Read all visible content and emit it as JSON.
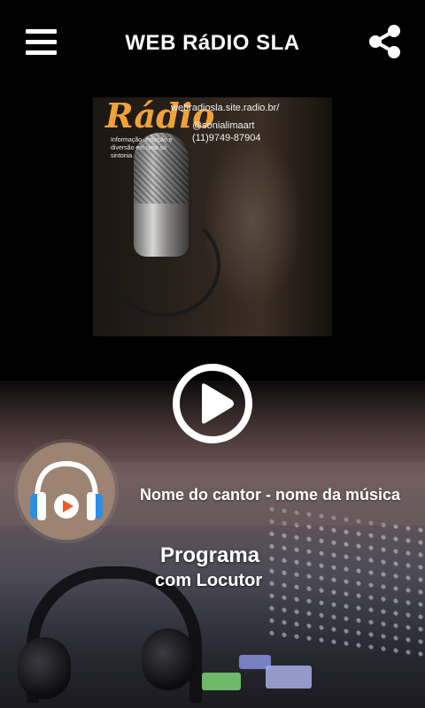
{
  "header": {
    "title": "WEB RáDIO SLA",
    "menu_icon": "hamburger-menu-icon",
    "share_icon": "share-icon"
  },
  "album_art": {
    "logo_text": "Rádio",
    "tagline": "Informação, emoção e diversão em uma só sintonia",
    "url": "webradiosla.site.radio.br/",
    "instagram": "@sonialimaart",
    "phone": "(11)9749-87904"
  },
  "player": {
    "play_icon": "play-icon",
    "station_logo_icon": "headphones-icon",
    "now_playing": "Nome do cantor - nome da música",
    "program": "Programa",
    "host": "com Locutor"
  },
  "colors": {
    "background": "#000000",
    "text": "#ffffff",
    "logo_orange": "#f0a23a",
    "station_logo_bg": "#9c8372",
    "headphone_blue": "#2f8de4",
    "headphone_orange": "#f15a24"
  }
}
